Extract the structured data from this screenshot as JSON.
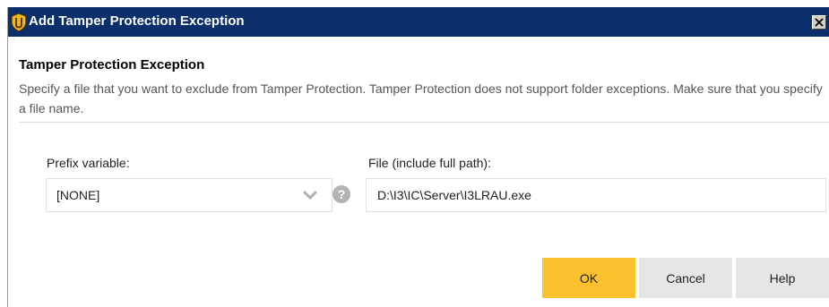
{
  "window": {
    "title": "Add Tamper Protection Exception",
    "close_icon": "close-icon",
    "app_icon": "shield-icon",
    "title_bar_color": "#0b2f6b"
  },
  "header": {
    "title": "Tamper Protection Exception",
    "description": "Specify a file that you want to exclude from Tamper Protection. Tamper Protection does not support folder exceptions. Make sure that you specify a file name."
  },
  "form": {
    "prefix_label": "Prefix variable:",
    "prefix_value": "[NONE]",
    "help_glyph": "?",
    "file_label": "File (include full path):",
    "file_value": "D:\\I3\\IC\\Server\\I3LRAU.exe"
  },
  "buttons": {
    "ok": "OK",
    "cancel": "Cancel",
    "help": "Help",
    "primary_color": "#fbc02d",
    "secondary_color": "#e6e6e6"
  }
}
